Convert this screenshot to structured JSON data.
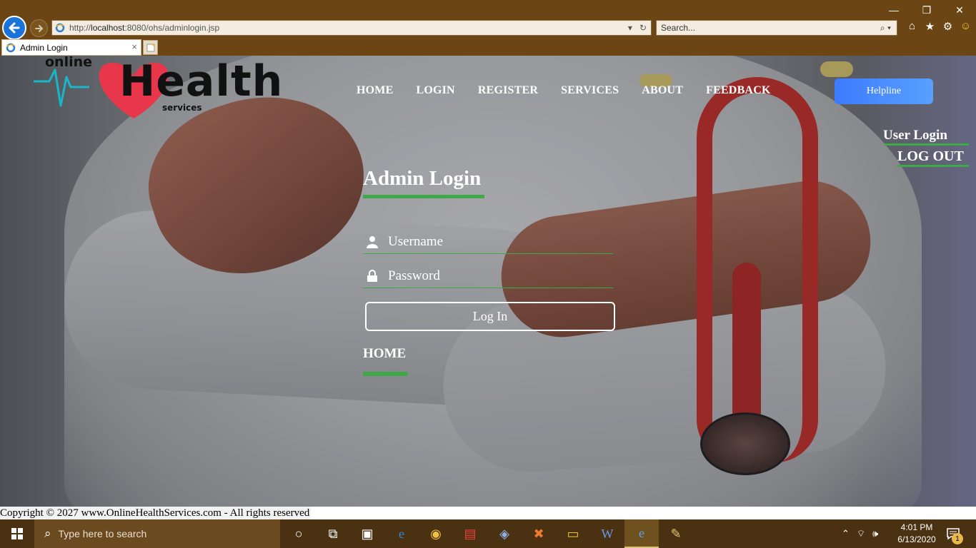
{
  "browser": {
    "address_prefix": "http://",
    "address_host": "localhost",
    "address_rest": ":8080/ohs/adminlogin.jsp",
    "search_placeholder": "Search...",
    "tab_title": "Admin Login",
    "tab_close": "×"
  },
  "logo": {
    "online": "online",
    "health": "Health",
    "services": "services"
  },
  "nav": {
    "items": [
      "HOME",
      "LOGIN",
      "REGISTER",
      "SERVICES",
      "ABOUT",
      "FEEDBACK"
    ],
    "helpline": "Helpline"
  },
  "side": {
    "user_login": "User Login",
    "logout": "LOG OUT"
  },
  "login": {
    "title": "Admin Login",
    "username_placeholder": "Username",
    "password_placeholder": "Password",
    "button": "Log In",
    "home_link": "HOME"
  },
  "footer": {
    "copyright": "Copyright © 2027 www.OnlineHealthServices.com - All rights reserved"
  },
  "taskbar": {
    "search_placeholder": "Type here to search",
    "time": "4:01 PM",
    "date": "6/13/2020",
    "notification_count": "1"
  },
  "colors": {
    "accent_green": "#3fa94a",
    "helpline_blue": "#3c7bff",
    "chrome_brown": "#6b4614"
  }
}
